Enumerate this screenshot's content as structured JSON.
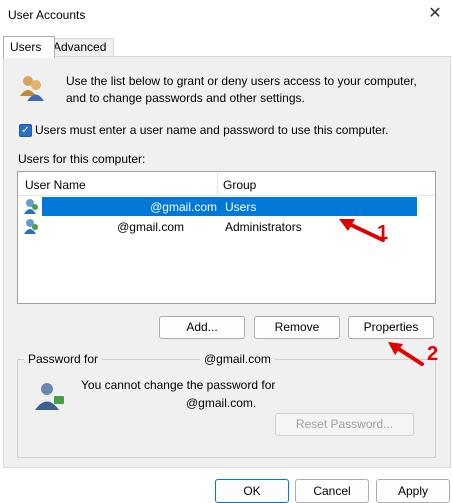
{
  "window": {
    "title": "User Accounts",
    "close_glyph": "✕"
  },
  "tabs": [
    {
      "label": "Users"
    },
    {
      "label": "Advanced"
    }
  ],
  "intro": {
    "text": "Use the list below to grant or deny users access to your computer, and to change passwords and other settings."
  },
  "checkbox": {
    "label": "Users must enter a user name and password to use this computer.",
    "checked": true
  },
  "users_section": {
    "label": "Users for this computer:"
  },
  "table": {
    "columns": [
      "User Name",
      "Group"
    ],
    "rows": [
      {
        "name": "@gmail.com",
        "group": "Users",
        "selected": true
      },
      {
        "name": "@gmail.com",
        "group": "Administrators",
        "selected": false
      }
    ]
  },
  "buttons": {
    "add": "Add...",
    "remove": "Remove",
    "properties": "Properties"
  },
  "password_group": {
    "legend": "Password for",
    "legend_user": "@gmail.com",
    "line1": "You cannot change the password for",
    "line2": "@gmail.com.",
    "reset": "Reset Password..."
  },
  "footer": {
    "ok": "OK",
    "cancel": "Cancel",
    "apply": "Apply"
  },
  "annotations": {
    "arrow1": "1",
    "arrow2": "2",
    "color": "#e00000"
  },
  "colors": {
    "selection": "#0078d7",
    "panel_bg": "#f0f0f0"
  }
}
